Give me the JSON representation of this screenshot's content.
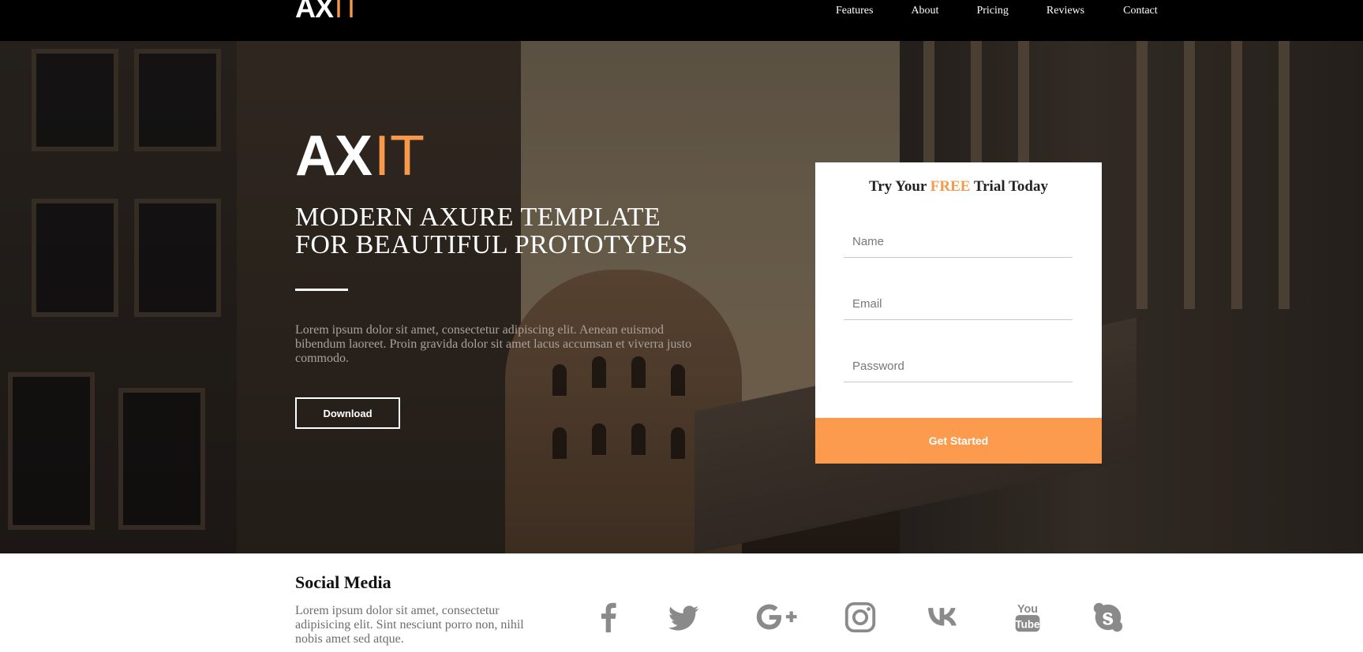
{
  "nav": {
    "logo_ax": "AX",
    "logo_it": "IT",
    "links": [
      "Features",
      "About",
      "Pricing",
      "Reviews",
      "Contact"
    ]
  },
  "hero": {
    "logo_ax": "AX",
    "logo_it": "IT",
    "title_line1": "MODERN AXURE TEMPLATE",
    "title_line2": "FOR BEAUTIFUL PROTOTYPES",
    "text": "Lorem ipsum dolor sit amet, consectetur adipiscing elit. Aenean euismod bibendum laoreet. Proin gravida dolor sit amet lacus accumsan et viverra justo commodo.",
    "download_label": "Download"
  },
  "trial": {
    "title_pre": "Try Your ",
    "title_free": "FREE",
    "title_post": " Trial Today",
    "name_placeholder": "Name",
    "email_placeholder": "Email",
    "password_placeholder": "Password",
    "button_label": "Get Started"
  },
  "social": {
    "title": "Social Media",
    "text": "Lorem ipsum dolor sit amet, consectetur adipisicing elit. Sint nesciunt porro non, nihil nobis amet sed atque.",
    "icons": [
      "facebook-icon",
      "twitter-icon",
      "google-plus-icon",
      "instagram-icon",
      "vk-icon",
      "youtube-icon",
      "skype-icon"
    ]
  },
  "colors": {
    "accent": "#f7994a",
    "button": "#fc9b4d",
    "nav_bg": "#000000",
    "icon_gray": "#8a8a8a"
  }
}
